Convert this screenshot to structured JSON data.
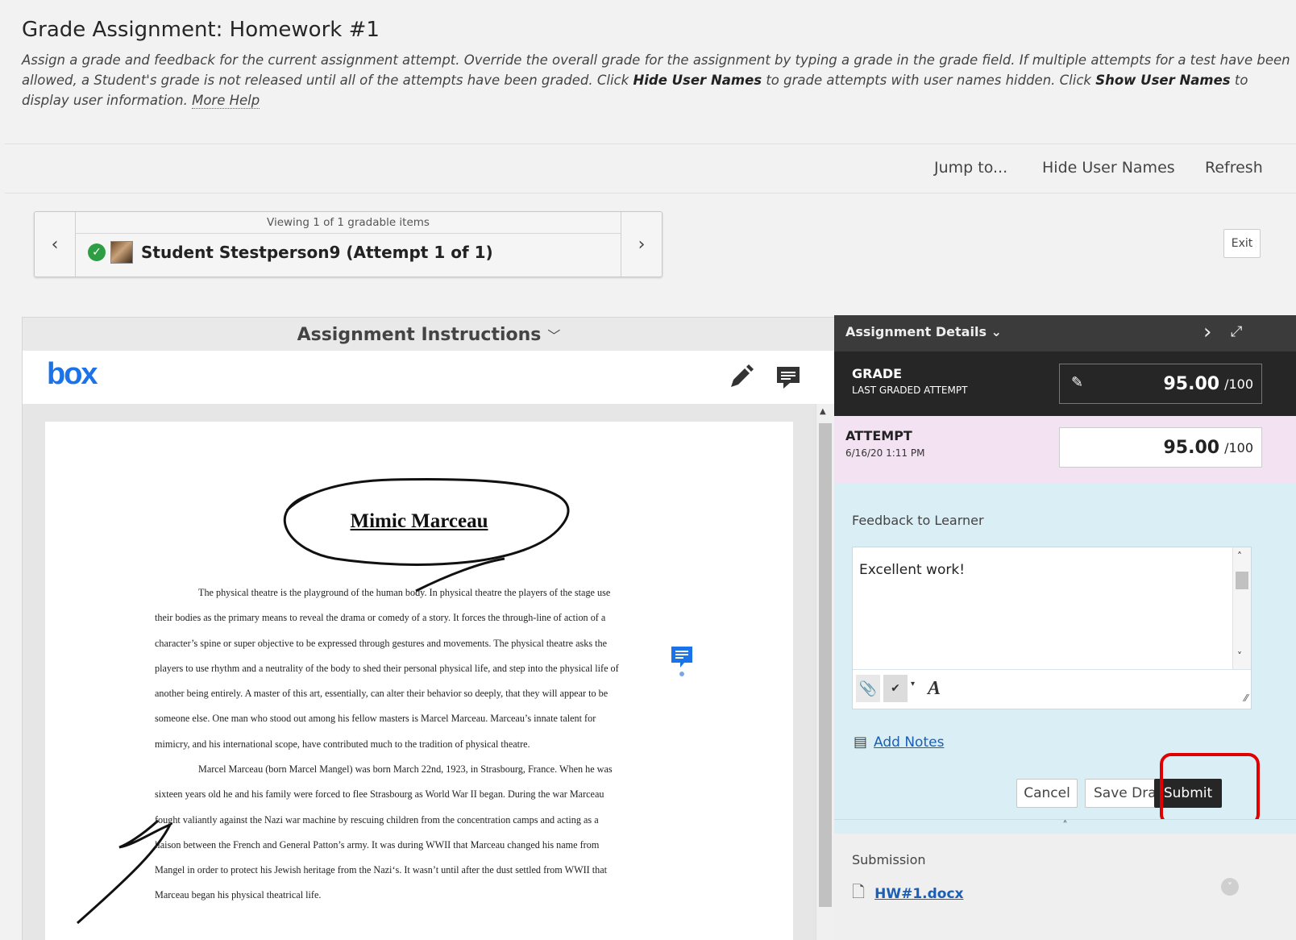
{
  "page": {
    "title": "Grade Assignment: Homework #1",
    "instructions": {
      "part1": "Assign a grade and feedback for the current assignment attempt. Override the overall grade for the assignment by typing a grade in the grade field. If multiple attempts for a test have been allowed, a Student's grade is not released until all of the attempts have been graded. Click ",
      "bold1": "Hide User Names",
      "part2": " to grade attempts with user names hidden. Click ",
      "bold2": "Show User Names",
      "part3": " to display user information. ",
      "more_help": "More Help"
    }
  },
  "actions": {
    "jump_to": "Jump to...",
    "hide_user_names": "Hide User Names",
    "refresh": "Refresh"
  },
  "navigator": {
    "caption": "Viewing 1 of 1 gradable items",
    "student": "Student Stestperson9 (Attempt 1 of 1)",
    "prev": "‹",
    "next": "›"
  },
  "exit": "Exit",
  "viewer": {
    "header": "Assignment Instructions",
    "logo": "box",
    "doc_title": "Mimic Marceau",
    "lines": [
      "The physical theatre is the playground of the human body.   In physical theatre the players of the stage use",
      "their bodies as the primary means to reveal the drama or comedy of a story.   It forces the through-line of action of a",
      "character’s spine or super objective to be expressed through gestures and movements.   The physical theatre asks the",
      "players to use rhythm and a neutrality of the body to shed their personal physical life, and step into the physical life of",
      "another being entirely.   A master of this art, essentially, can alter their behavior so deeply, that they will appear to be",
      "someone else.   One man who stood out among his fellow masters is Marcel Marceau.   Marceau’s innate talent for",
      "mimicry, and his international scope, have contributed much to the tradition of physical theatre.",
      "Marcel Marceau (born Marcel Mangel) was born March 22nd, 1923, in Strasbourg, France.   When he was",
      "sixteen years old he and his family were forced to flee Strasbourg as World War II began.   During the war Marceau",
      "fought valiantly against the Nazi war machine by rescuing children from the concentration camps and acting as a",
      "liaison between the French and General Patton’s army.   It was during WWII that Marceau changed his name from",
      "Mangel in order to protect his Jewish heritage from the Nazi‘s.   It wasn’t until after the dust settled from WWII that",
      "Marceau began his physical theatrical life."
    ]
  },
  "details": {
    "header": "Assignment Details",
    "grade_label": "GRADE",
    "grade_sub": "LAST GRADED ATTEMPT",
    "grade_value": "95.00",
    "grade_max": "/100",
    "attempt_label": "ATTEMPT",
    "attempt_date": "6/16/20 1:11 PM",
    "attempt_value": "95.00",
    "attempt_max": "/100",
    "feedback_label": "Feedback to Learner",
    "feedback_text": "Excellent work!",
    "add_notes": "Add Notes",
    "cancel": "Cancel",
    "save_draft": "Save Draft",
    "submit": "Submit",
    "submission_label": "Submission",
    "submission_file": "HW#1.docx"
  },
  "colors": {
    "accent_blue": "#1a73e8",
    "submit_bg": "#262626",
    "highlight": "#e00000",
    "check_green": "#2e9e44"
  }
}
